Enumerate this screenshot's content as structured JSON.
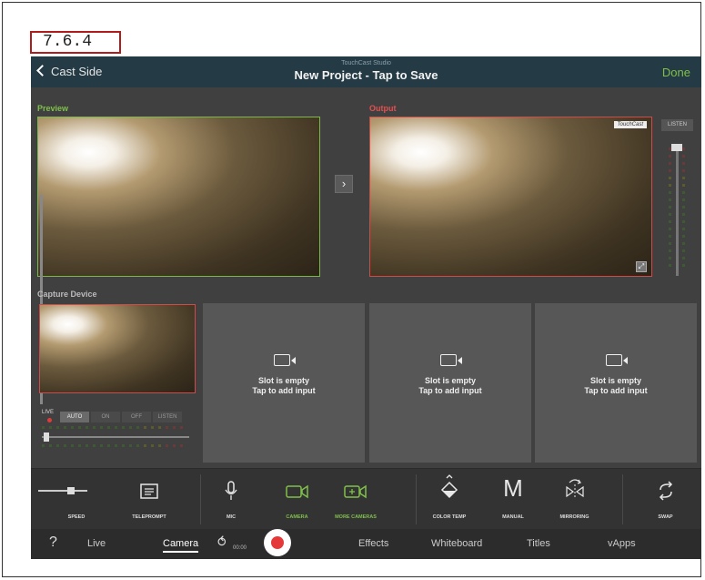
{
  "section_tag": "7.6.4",
  "topbar": {
    "back_label": "Cast Side",
    "app_name": "TouchCast Studio",
    "title": "New Project - Tap to Save",
    "done_label": "Done"
  },
  "panels": {
    "preview_label": "Preview",
    "output_label": "Output",
    "watermark": "TouchCast",
    "listen_label": "LISTEN",
    "capture_label": "Capture Device"
  },
  "slots": [
    {
      "line1": "Slot is empty",
      "line2": "Tap to add input"
    },
    {
      "line1": "Slot is empty",
      "line2": "Tap to add input"
    },
    {
      "line1": "Slot is empty",
      "line2": "Tap to add input"
    }
  ],
  "capture_controls": {
    "live_label": "LIVE",
    "modes": [
      "AUTO",
      "ON",
      "OFF",
      "LISTEN"
    ],
    "selected_mode": "AUTO"
  },
  "tools": {
    "speed": "SPEED",
    "teleprompt": "TELEPROMPT",
    "mic": "MIC",
    "camera": "CAMERA",
    "more_cameras": "MORE CAMERAS",
    "color_temp": "COLOR TEMP",
    "manual": "MANUAL",
    "manual_glyph": "M",
    "mirroring": "MIRRORING",
    "swap": "SWAP"
  },
  "nav": {
    "help": "?",
    "live": "Live",
    "camera": "Camera",
    "timer": "00:00",
    "effects": "Effects",
    "whiteboard": "Whiteboard",
    "titles": "Titles",
    "vapps": "vApps",
    "active_tab": "Camera"
  },
  "colors": {
    "accent_green": "#7fc04a",
    "record_red": "#e53838",
    "output_border": "#d04a4a",
    "topbar_bg": "#243a44"
  }
}
